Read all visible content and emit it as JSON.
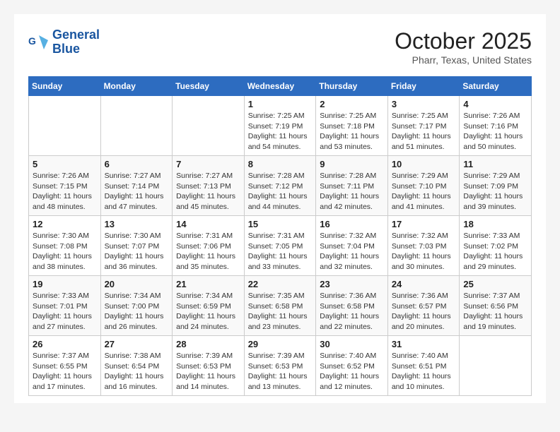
{
  "header": {
    "logo_line1": "General",
    "logo_line2": "Blue",
    "month_title": "October 2025",
    "location": "Pharr, Texas, United States"
  },
  "weekdays": [
    "Sunday",
    "Monday",
    "Tuesday",
    "Wednesday",
    "Thursday",
    "Friday",
    "Saturday"
  ],
  "weeks": [
    [
      {
        "day": "",
        "info": ""
      },
      {
        "day": "",
        "info": ""
      },
      {
        "day": "",
        "info": ""
      },
      {
        "day": "1",
        "info": "Sunrise: 7:25 AM\nSunset: 7:19 PM\nDaylight: 11 hours\nand 54 minutes."
      },
      {
        "day": "2",
        "info": "Sunrise: 7:25 AM\nSunset: 7:18 PM\nDaylight: 11 hours\nand 53 minutes."
      },
      {
        "day": "3",
        "info": "Sunrise: 7:25 AM\nSunset: 7:17 PM\nDaylight: 11 hours\nand 51 minutes."
      },
      {
        "day": "4",
        "info": "Sunrise: 7:26 AM\nSunset: 7:16 PM\nDaylight: 11 hours\nand 50 minutes."
      }
    ],
    [
      {
        "day": "5",
        "info": "Sunrise: 7:26 AM\nSunset: 7:15 PM\nDaylight: 11 hours\nand 48 minutes."
      },
      {
        "day": "6",
        "info": "Sunrise: 7:27 AM\nSunset: 7:14 PM\nDaylight: 11 hours\nand 47 minutes."
      },
      {
        "day": "7",
        "info": "Sunrise: 7:27 AM\nSunset: 7:13 PM\nDaylight: 11 hours\nand 45 minutes."
      },
      {
        "day": "8",
        "info": "Sunrise: 7:28 AM\nSunset: 7:12 PM\nDaylight: 11 hours\nand 44 minutes."
      },
      {
        "day": "9",
        "info": "Sunrise: 7:28 AM\nSunset: 7:11 PM\nDaylight: 11 hours\nand 42 minutes."
      },
      {
        "day": "10",
        "info": "Sunrise: 7:29 AM\nSunset: 7:10 PM\nDaylight: 11 hours\nand 41 minutes."
      },
      {
        "day": "11",
        "info": "Sunrise: 7:29 AM\nSunset: 7:09 PM\nDaylight: 11 hours\nand 39 minutes."
      }
    ],
    [
      {
        "day": "12",
        "info": "Sunrise: 7:30 AM\nSunset: 7:08 PM\nDaylight: 11 hours\nand 38 minutes."
      },
      {
        "day": "13",
        "info": "Sunrise: 7:30 AM\nSunset: 7:07 PM\nDaylight: 11 hours\nand 36 minutes."
      },
      {
        "day": "14",
        "info": "Sunrise: 7:31 AM\nSunset: 7:06 PM\nDaylight: 11 hours\nand 35 minutes."
      },
      {
        "day": "15",
        "info": "Sunrise: 7:31 AM\nSunset: 7:05 PM\nDaylight: 11 hours\nand 33 minutes."
      },
      {
        "day": "16",
        "info": "Sunrise: 7:32 AM\nSunset: 7:04 PM\nDaylight: 11 hours\nand 32 minutes."
      },
      {
        "day": "17",
        "info": "Sunrise: 7:32 AM\nSunset: 7:03 PM\nDaylight: 11 hours\nand 30 minutes."
      },
      {
        "day": "18",
        "info": "Sunrise: 7:33 AM\nSunset: 7:02 PM\nDaylight: 11 hours\nand 29 minutes."
      }
    ],
    [
      {
        "day": "19",
        "info": "Sunrise: 7:33 AM\nSunset: 7:01 PM\nDaylight: 11 hours\nand 27 minutes."
      },
      {
        "day": "20",
        "info": "Sunrise: 7:34 AM\nSunset: 7:00 PM\nDaylight: 11 hours\nand 26 minutes."
      },
      {
        "day": "21",
        "info": "Sunrise: 7:34 AM\nSunset: 6:59 PM\nDaylight: 11 hours\nand 24 minutes."
      },
      {
        "day": "22",
        "info": "Sunrise: 7:35 AM\nSunset: 6:58 PM\nDaylight: 11 hours\nand 23 minutes."
      },
      {
        "day": "23",
        "info": "Sunrise: 7:36 AM\nSunset: 6:58 PM\nDaylight: 11 hours\nand 22 minutes."
      },
      {
        "day": "24",
        "info": "Sunrise: 7:36 AM\nSunset: 6:57 PM\nDaylight: 11 hours\nand 20 minutes."
      },
      {
        "day": "25",
        "info": "Sunrise: 7:37 AM\nSunset: 6:56 PM\nDaylight: 11 hours\nand 19 minutes."
      }
    ],
    [
      {
        "day": "26",
        "info": "Sunrise: 7:37 AM\nSunset: 6:55 PM\nDaylight: 11 hours\nand 17 minutes."
      },
      {
        "day": "27",
        "info": "Sunrise: 7:38 AM\nSunset: 6:54 PM\nDaylight: 11 hours\nand 16 minutes."
      },
      {
        "day": "28",
        "info": "Sunrise: 7:39 AM\nSunset: 6:53 PM\nDaylight: 11 hours\nand 14 minutes."
      },
      {
        "day": "29",
        "info": "Sunrise: 7:39 AM\nSunset: 6:53 PM\nDaylight: 11 hours\nand 13 minutes."
      },
      {
        "day": "30",
        "info": "Sunrise: 7:40 AM\nSunset: 6:52 PM\nDaylight: 11 hours\nand 12 minutes."
      },
      {
        "day": "31",
        "info": "Sunrise: 7:40 AM\nSunset: 6:51 PM\nDaylight: 11 hours\nand 10 minutes."
      },
      {
        "day": "",
        "info": ""
      }
    ]
  ]
}
